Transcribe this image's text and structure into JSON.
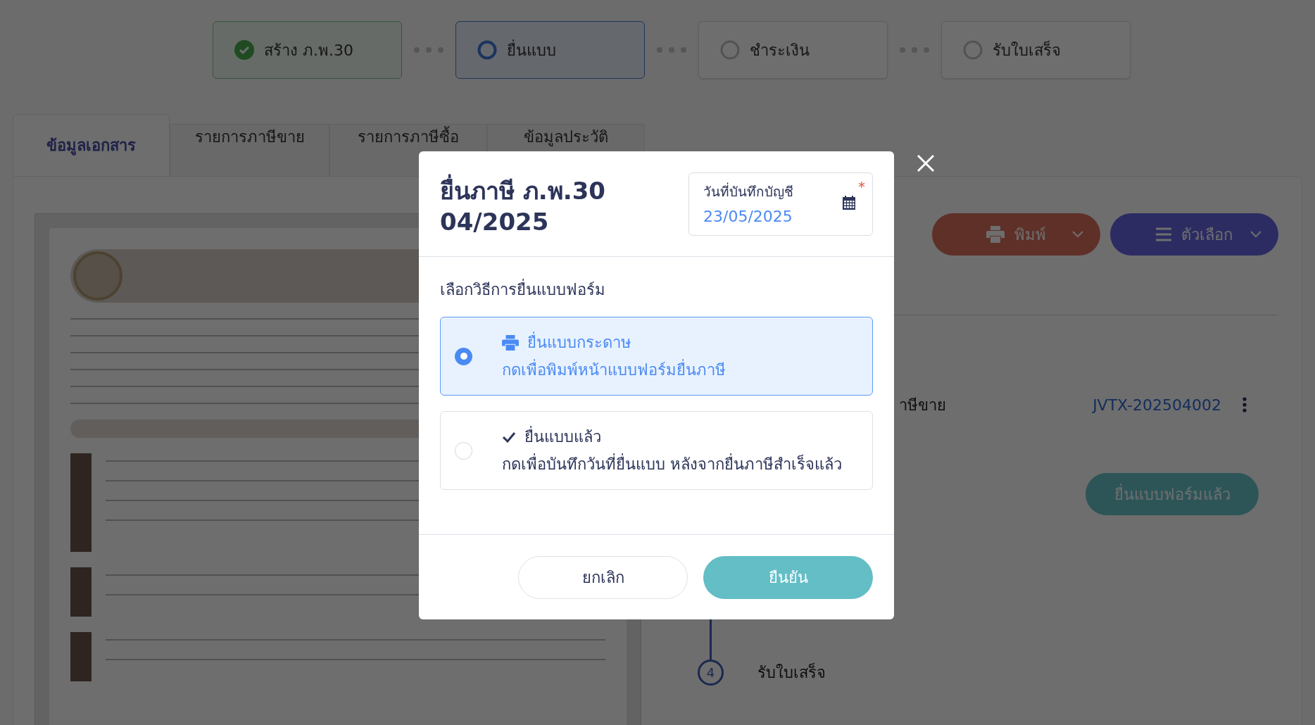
{
  "steps": [
    {
      "label": "สร้าง ภ.พ.30",
      "completed": true,
      "selected": false
    },
    {
      "label": "ยื่นแบบ",
      "completed": false,
      "selected": true
    },
    {
      "label": "ชำระเงิน",
      "completed": false,
      "selected": false
    },
    {
      "label": "รับใบเสร็จ",
      "completed": false,
      "selected": false
    }
  ],
  "tabs": [
    {
      "label": "ข้อมูลเอกสาร",
      "selected": true
    },
    {
      "label": "รายการภาษีขาย",
      "selected": false
    },
    {
      "label": "รายการภาษีซื้อ",
      "selected": false
    },
    {
      "label": "ข้อมูลประวัติ",
      "selected": false
    }
  ],
  "toolbar": {
    "print_button": "พิมพ์",
    "options_button": "ตัวเลือก"
  },
  "document_row": {
    "label": "าษีขาย",
    "link": "JVTX-202504002"
  },
  "filed_button": "ยื่นแบบฟอร์มแล้ว",
  "timeline": [
    {
      "number": "4",
      "label": "รับใบเสร็จ"
    }
  ],
  "modal": {
    "title_lines": [
      "ยื่นภาษี ภ.พ.30",
      "04/2025"
    ],
    "date_field": {
      "label": "วันที่บันทึกบัญชี",
      "required_mark": "*",
      "value": "23/05/2025"
    },
    "section_label": "เลือกวิธีการยื่นแบบฟอร์ม",
    "options": [
      {
        "kind": "print",
        "title": "ยื่นแบบกระดาษ",
        "description": "กดเพื่อพิมพ์หน้าแบบฟอร์มยื่นภาษี",
        "selected": true
      },
      {
        "kind": "check",
        "title": "ยื่นแบบแล้ว",
        "description": "กดเพื่อบันทึกวันที่ยื่นแบบ หลังจากยื่นภาษีสำเร็จแล้ว",
        "selected": false
      }
    ],
    "buttons": {
      "cancel": "ยกเลิก",
      "confirm": "ยืนยัน"
    }
  }
}
